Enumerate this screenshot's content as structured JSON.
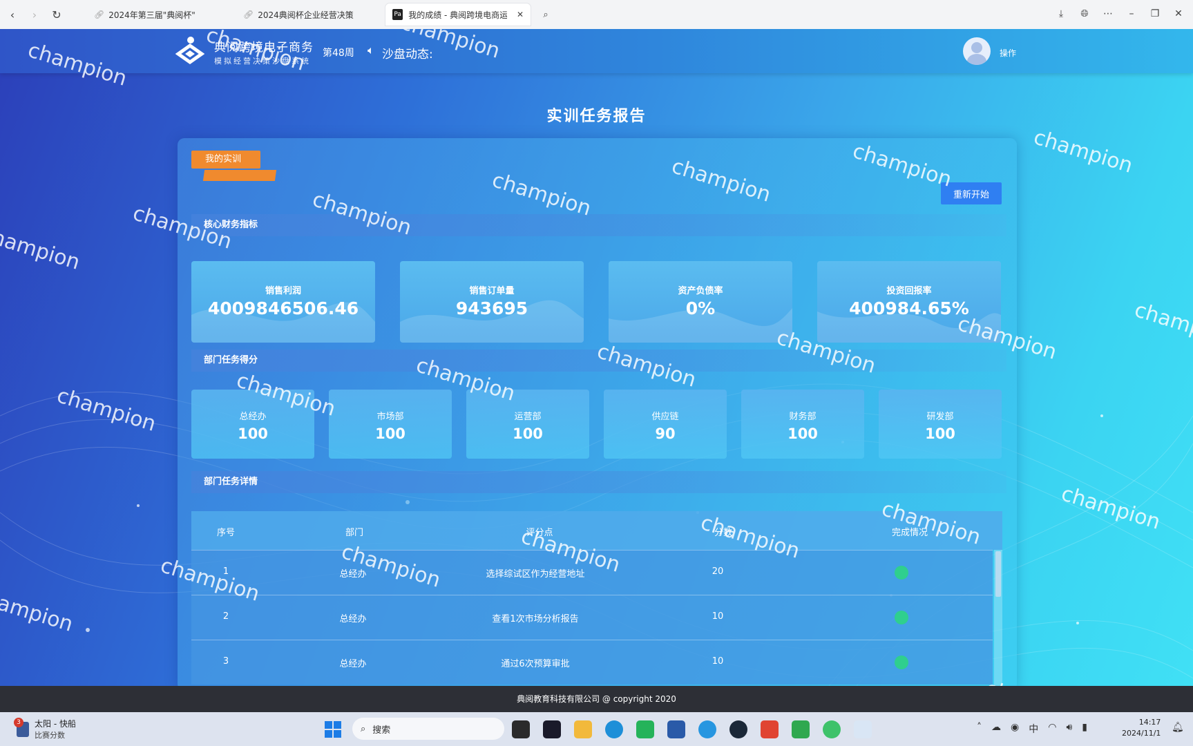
{
  "browser": {
    "tabs": [
      {
        "title": "2024年第三届\"典阅杯\""
      },
      {
        "title": "2024典阅杯企业经营决策"
      },
      {
        "title": "我的成绩 - 典阅跨境电商运营"
      }
    ]
  },
  "header": {
    "brand_title": "典阅跨境电子商务",
    "brand_subtitle": "模拟经营决策沙盘系统",
    "week": "第48周",
    "dynamic_label": "沙盘动态:",
    "operate_label": "操作"
  },
  "report": {
    "title": "实训任务报告",
    "my_training_label": "我的实训",
    "restart_label": "重新开始"
  },
  "sections": {
    "core_finance": "核心财务指标",
    "dept_scores": "部门任务得分",
    "dept_details": "部门任务详情"
  },
  "kpis": [
    {
      "label": "销售利润",
      "value": "4009846506.46"
    },
    {
      "label": "销售订单量",
      "value": "943695"
    },
    {
      "label": "资产负债率",
      "value": "0%"
    },
    {
      "label": "投资回报率",
      "value": "400984.65%"
    }
  ],
  "departments": [
    {
      "label": "总经办",
      "score": "100"
    },
    {
      "label": "市场部",
      "score": "100"
    },
    {
      "label": "运营部",
      "score": "100"
    },
    {
      "label": "供应链",
      "score": "90"
    },
    {
      "label": "财务部",
      "score": "100"
    },
    {
      "label": "研发部",
      "score": "100"
    }
  ],
  "table": {
    "columns": [
      "序号",
      "部门",
      "评分点",
      "分数",
      "完成情况"
    ],
    "rows": [
      {
        "no": "1",
        "dept": "总经办",
        "point": "选择综试区作为经营地址",
        "score": "20",
        "status": "check-icon"
      },
      {
        "no": "2",
        "dept": "总经办",
        "point": "查看1次市场分析报告",
        "score": "10",
        "status": "check-icon"
      },
      {
        "no": "3",
        "dept": "总经办",
        "point": "通过6次预算审批",
        "score": "10",
        "status": "check-icon"
      }
    ]
  },
  "footer": {
    "text": "典阅教育科技有限公司 @ copyright 2020"
  },
  "taskbar": {
    "weather_title": "太阳 - 快船",
    "weather_subtitle": "比赛分数",
    "weather_badge": "3",
    "search_placeholder": "搜索",
    "ime": "中",
    "time": "14:17",
    "date": "2024/11/1"
  },
  "watermark": "champion",
  "colors": {
    "accent_orange": "#f08a2e",
    "restart_blue": "#2f7ff2",
    "check_green": "#2fcf8e",
    "footer_bg": "#2d2f36"
  }
}
